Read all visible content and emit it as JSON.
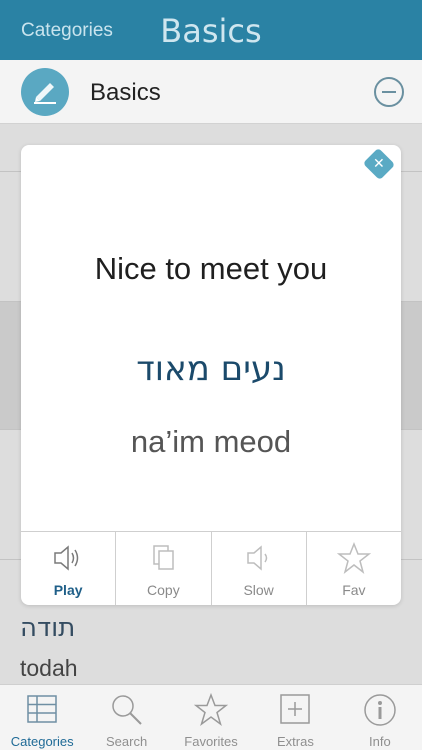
{
  "nav": {
    "back_label": "Categories",
    "title": "Basics"
  },
  "category": {
    "title": "Basics",
    "icon": "writing-hand-icon"
  },
  "list_rows": [
    {
      "hebrew": "",
      "translit": ""
    },
    {
      "hebrew": "",
      "translit": ""
    },
    {
      "hebrew": "",
      "translit": ""
    },
    {
      "hebrew": "תודה",
      "translit": "todah"
    }
  ],
  "modal": {
    "english": "Nice to meet you",
    "hebrew": "נעים מאוד",
    "translit": "na’im meod",
    "actions": [
      {
        "label": "Play",
        "icon": "speaker-icon",
        "active": true
      },
      {
        "label": "Copy",
        "icon": "copy-icon",
        "active": false
      },
      {
        "label": "Slow",
        "icon": "speaker-slow-icon",
        "active": false
      },
      {
        "label": "Fav",
        "icon": "star-icon",
        "active": false
      }
    ]
  },
  "tabs": [
    {
      "label": "Categories",
      "icon": "list-icon",
      "active": true
    },
    {
      "label": "Search",
      "icon": "search-icon",
      "active": false
    },
    {
      "label": "Favorites",
      "icon": "star-icon",
      "active": false
    },
    {
      "label": "Extras",
      "icon": "plus-box-icon",
      "active": false
    },
    {
      "label": "Info",
      "icon": "info-icon",
      "active": false
    }
  ],
  "colors": {
    "accent": "#2a82a4",
    "active_label": "#1f6a96"
  }
}
